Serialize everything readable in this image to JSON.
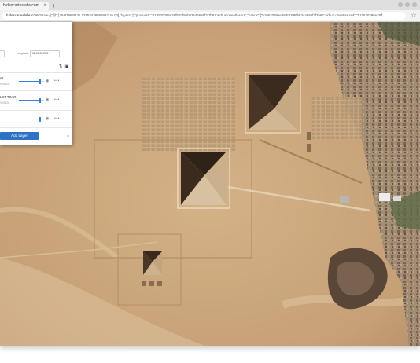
{
  "browser": {
    "tab_label": "h.descarteslabs.com",
    "tab_close": "×",
    "new_tab": "+",
    "url_host": "h.descarteslabs.com",
    "url_rest": "/?state={\"@\":[29.979668,31.13153438888892,16.00],\"layers\":[{\"products\":\"510520295e28fF33f86b83446696f3f7b67:airbus:oneatlas:v1\",\"bands\":[\"510520295e28fF33f86b8344696f3f7b67:airbus:oneatlas:red\",\"510520295e28ff",
    "bookmark_icon": "star-icon"
  },
  "panel": {
    "latitude_label": "",
    "longitude_label": "Longitude",
    "latitude_value": "",
    "longitude_value": "31.131534389",
    "layers": [
      {
        "name": "s2",
        "date": "9-08-28",
        "opacity": 0.85
      },
      {
        "name": "LST-TOAR",
        "date": "9-08-28",
        "opacity": 0.85
      },
      {
        "name": "",
        "date": "",
        "opacity": 0.85
      }
    ],
    "add_layer_label": "Add Layer"
  },
  "colors": {
    "accent": "#2f72c2",
    "sand": "#c9a57a"
  }
}
